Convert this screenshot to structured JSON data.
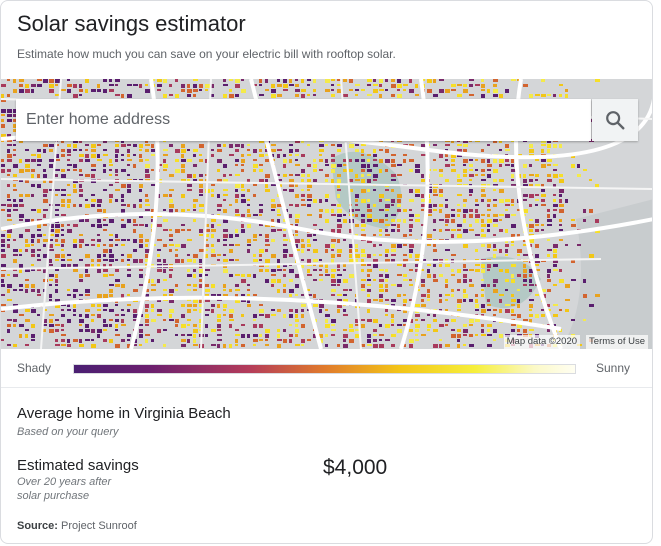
{
  "header": {
    "title": "Solar savings estimator",
    "subtitle": "Estimate how much you can save on your electric bill with rooftop solar."
  },
  "search": {
    "placeholder": "Enter home address",
    "button_icon": "search-icon"
  },
  "map": {
    "attribution": "Map data ©2020",
    "terms_link": "Terms of Use"
  },
  "legend": {
    "low_label": "Shady",
    "high_label": "Sunny"
  },
  "result": {
    "title": "Average home in Virginia Beach",
    "subtitle": "Based on your query",
    "savings_label": "Estimated savings",
    "savings_note": "Over 20 years after solar purchase",
    "savings_value": "$4,000"
  },
  "footer": {
    "source_label": "Source:",
    "source_value": "Project Sunroof"
  },
  "colors": {
    "shady": "#4a1f72",
    "mid": "#e07a2c",
    "sunny": "#f6ef3c",
    "map_background": "#d4d6d8",
    "water": "#b4c9c5"
  }
}
